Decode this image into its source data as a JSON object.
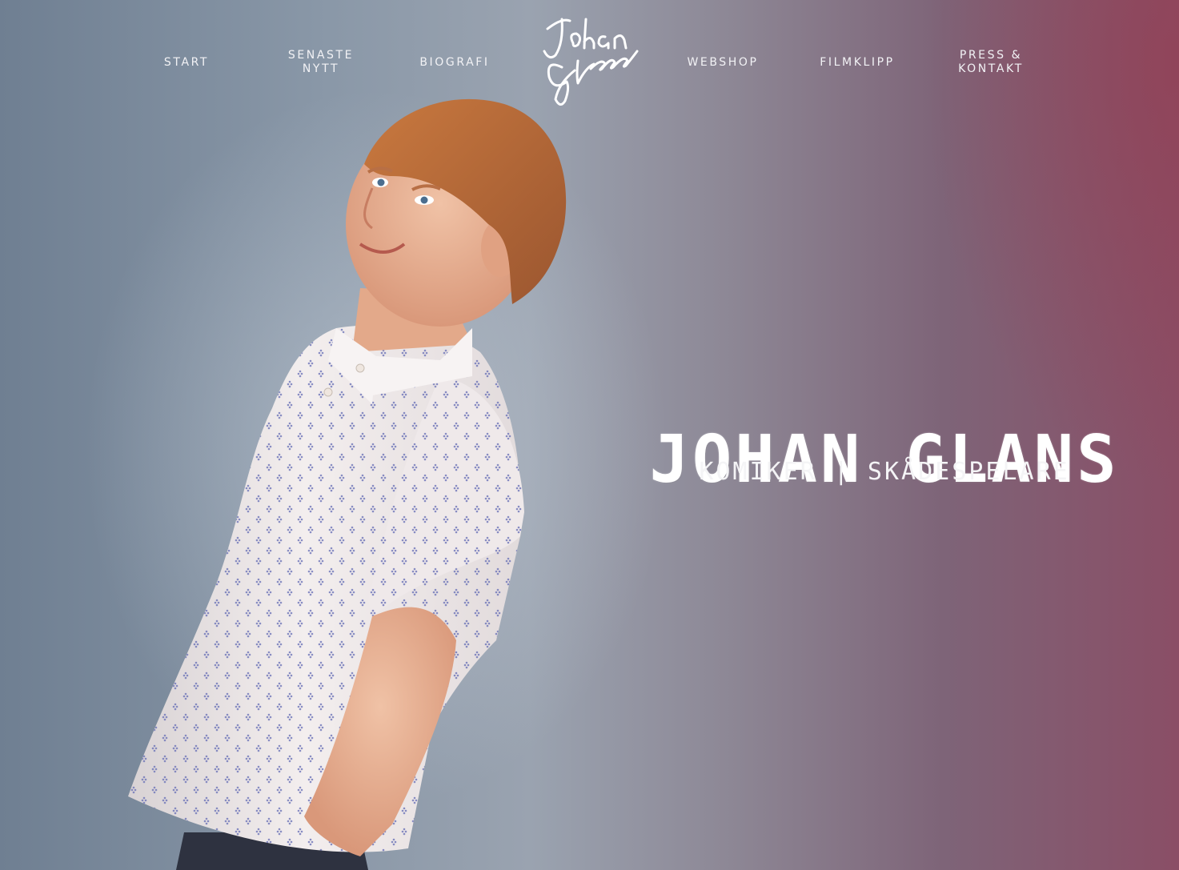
{
  "nav": {
    "items": [
      {
        "label": "START"
      },
      {
        "label": "SENASTE\nNYTT"
      },
      {
        "label": "BIOGRAFI"
      },
      {
        "label": "WEBSHOP"
      },
      {
        "label": "FILMKLIPP"
      },
      {
        "label": "PRESS &\nKONTAKT"
      }
    ],
    "logo": {
      "text": "Johan Glans",
      "icon": "signature-logo-icon"
    }
  },
  "hero": {
    "title": "JOHAN GLANS",
    "subtitle": "KOMIKER | SKÅDESPELARE",
    "image": {
      "icon": "portrait-photo"
    }
  },
  "colors": {
    "left_background": "#6f7f92",
    "right_background": "#8a4e66",
    "text": "#ffffff",
    "shirt": "#ece6e4",
    "hair": "#b8683a"
  }
}
